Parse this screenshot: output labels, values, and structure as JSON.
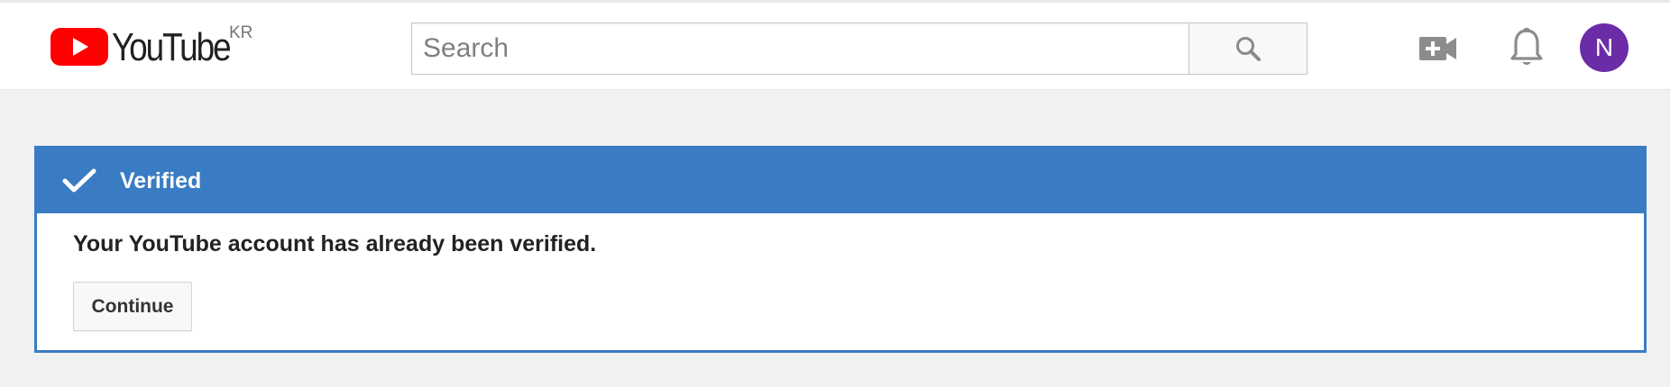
{
  "header": {
    "logo_text": "YouTube",
    "region": "KR",
    "search_placeholder": "Search",
    "avatar_initial": "N",
    "icons": [
      "youtube-logo-icon",
      "search-icon",
      "video-camera-plus-icon",
      "bell-icon"
    ]
  },
  "colors": {
    "brand_red": "#ff0000",
    "accent_blue": "#3a7cc4",
    "avatar_purple": "#6b2ca8"
  },
  "verification": {
    "title": "Verified",
    "message": "Your YouTube account has already been verified.",
    "continue_label": "Continue"
  }
}
